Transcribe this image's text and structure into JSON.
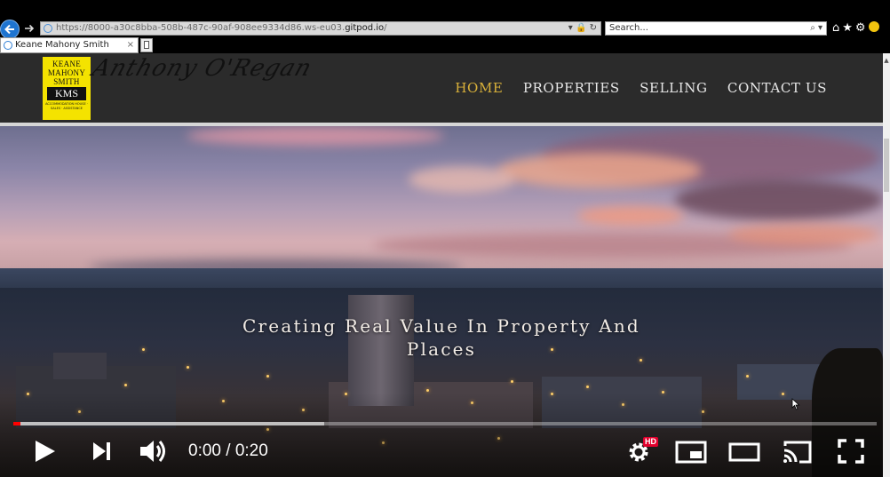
{
  "browser": {
    "url_prefix": "https://8000-a30c8bba-508b-487c-90af-908ee9334d86.ws-eu03.",
    "url_domain": "gitpod.io",
    "url_suffix": "/",
    "search_placeholder": "Search...",
    "tab_title": "Keane Mahony Smith",
    "tab_close": "×"
  },
  "site": {
    "logo_lines": [
      "KEANE",
      "MAHONY",
      "SMITH"
    ],
    "logo_abbr": "KMS",
    "logo_small": "ACCOMMODATION HOUSE · SALES · ASSISTANCE",
    "signature": "Anthony O'Regan",
    "nav": [
      {
        "label": "HOME",
        "active": true
      },
      {
        "label": "PROPERTIES",
        "active": false
      },
      {
        "label": "SELLING",
        "active": false
      },
      {
        "label": "CONTACT US",
        "active": false
      }
    ]
  },
  "hero": {
    "title": "Creating Real Value In Property And Places"
  },
  "video": {
    "time": "0:00 / 0:20",
    "hd_badge": "HD",
    "played_fraction": 0.008,
    "buffered_fraction": 0.36
  }
}
